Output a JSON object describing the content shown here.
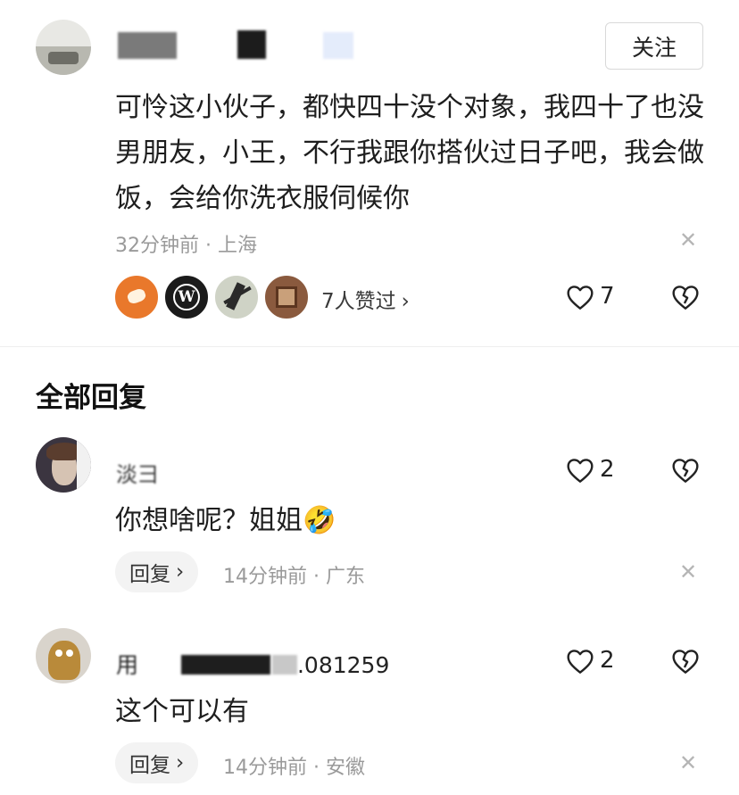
{
  "post": {
    "follow_label": "关注",
    "text": "可怜这小伙子，都快四十没个对象，我四十了也没男朋友，小王，不行我跟你搭伙过日子吧，我会做饭，会给你洗衣服伺候你",
    "time": "32分钟前",
    "location": "上海",
    "likers_label": "7人赞过",
    "like_count": "7"
  },
  "replies_section": {
    "title": "全部回复"
  },
  "replies": [
    {
      "username": "淡⺕",
      "text": "你想啥呢？姐姐",
      "emoji": "🤣",
      "like_count": "2",
      "reply_label": "回复",
      "time": "14分钟前",
      "location": "广东"
    },
    {
      "username_prefix": "用",
      "username_suffix": ".081259",
      "text": "这个可以有",
      "like_count": "2",
      "reply_label": "回复",
      "time": "14分钟前",
      "location": "安徽"
    }
  ],
  "icons": {
    "like": "heart-outline-icon",
    "dislike": "broken-heart-icon",
    "close": "close-icon",
    "chevron": "chevron-right-icon"
  },
  "colors": {
    "meta_text": "#9a9a9a",
    "reply_button_bg": "#f3f3f3",
    "divider": "#eeeeee"
  }
}
